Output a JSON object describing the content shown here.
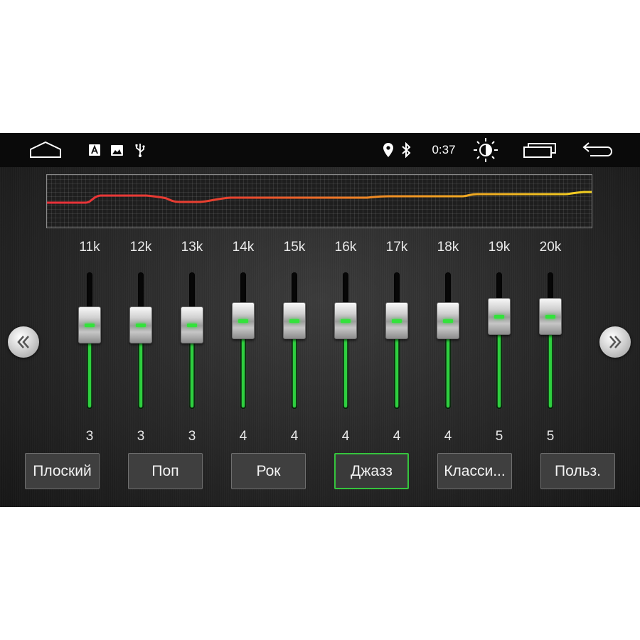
{
  "statusbar": {
    "time": "0:37",
    "icons": [
      "home-icon",
      "app-icon",
      "image-icon",
      "usb-icon",
      "location-icon",
      "bluetooth-icon",
      "brightness-icon",
      "recent-apps-icon",
      "back-icon"
    ]
  },
  "colors": {
    "accent": "#2ecf3f",
    "curve_start": "#e8303a",
    "curve_end": "#f2d021",
    "background": "#262626"
  },
  "equalizer": {
    "bands": [
      {
        "freq": "11k",
        "value": "3"
      },
      {
        "freq": "12k",
        "value": "3"
      },
      {
        "freq": "13k",
        "value": "3"
      },
      {
        "freq": "14k",
        "value": "4"
      },
      {
        "freq": "15k",
        "value": "4"
      },
      {
        "freq": "16k",
        "value": "4"
      },
      {
        "freq": "17k",
        "value": "4"
      },
      {
        "freq": "18k",
        "value": "4"
      },
      {
        "freq": "19k",
        "value": "5"
      },
      {
        "freq": "20k",
        "value": "5"
      }
    ],
    "prev_page_icon": "double-chevron-left-icon",
    "next_page_icon": "double-chevron-right-icon"
  },
  "presets": [
    {
      "label": "Плоский"
    },
    {
      "label": "Поп"
    },
    {
      "label": "Рок"
    },
    {
      "label": "Джазз",
      "selected": true
    },
    {
      "label": "Класси..."
    },
    {
      "label": "Польз."
    }
  ]
}
